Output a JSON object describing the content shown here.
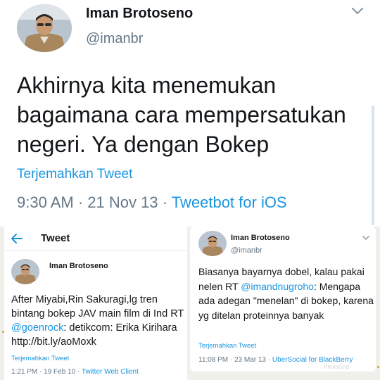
{
  "main_tweet": {
    "name": "Iman Brotoseno",
    "handle": "@imanbr",
    "text": "Akhirnya kita menemukan bagaimana cara mempersatukan negeri. Ya dengan Bokep",
    "translate": "Terjemahkan Tweet",
    "time": "9:30 AM",
    "date": "21 Nov 13",
    "source": "Tweetbot for iOS",
    "menu_icon": "chevron-down-icon"
  },
  "left_tweet": {
    "header_title": "Tweet",
    "back_icon": "back-arrow-icon",
    "name": "Iman Brotoseno",
    "text_before": "After Miyabi,Rin Sakuragi,lg tren bintang bokep JAV main film di Ind  RT ",
    "mention": "@goenrock",
    "text_after": ": detikcom: Erika Kirihara http://bit.ly/aoMoxk",
    "translate": "Terjemahkan Tweet",
    "time": "1:21 PM",
    "date": "19 Feb 10",
    "source": "Twitter Web Client"
  },
  "right_tweet": {
    "name": "Iman Brotoseno",
    "handle": "@imanbr",
    "text_before": "Biasanya bayarnya dobel, kalau pakai nelen RT ",
    "mention": "@imandnugroho",
    "text_after": ": Mengapa ada adegan \"menelan\" di bokep, karena yg ditelan proteinnya banyak",
    "translate": "Terjemahkan Tweet",
    "time": "11:08 PM",
    "date": "23 Mar 13",
    "source": "UberSocial for BlackBerry",
    "menu_icon": "chevron-down-icon"
  },
  "watermark": "PhotoGrid",
  "colors": {
    "link_blue": "#1b95e0",
    "secondary_gray": "#657786",
    "text_dark": "#14171a",
    "background": "#f1efe9",
    "gold_dots": "#c9a23a"
  }
}
